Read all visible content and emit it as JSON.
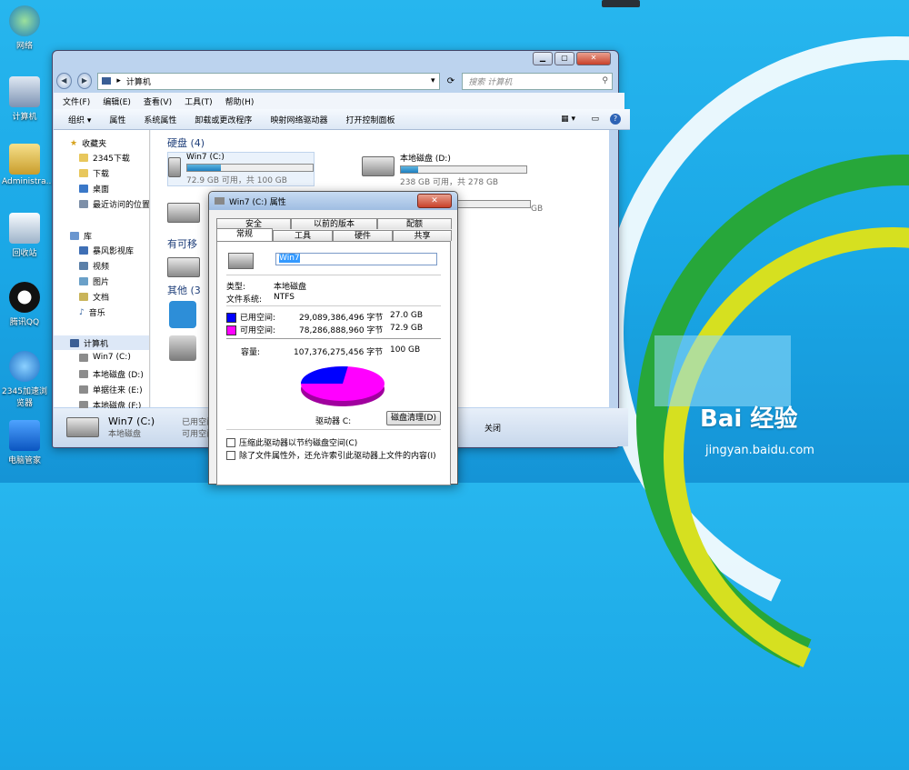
{
  "desktop": {
    "icons": [
      {
        "label": "网络",
        "name": "network-icon"
      },
      {
        "label": "计算机",
        "name": "computer-icon"
      },
      {
        "label": "Administra...",
        "name": "user-folder-icon"
      },
      {
        "label": "回收站",
        "name": "recycle-bin-icon"
      },
      {
        "label": "腾讯QQ",
        "name": "qq-icon"
      },
      {
        "label": "2345加速浏览器",
        "name": "browser-icon"
      },
      {
        "label": "电脑管家",
        "name": "pc-manager-icon"
      }
    ],
    "watermark": {
      "logo": "Bai 经验",
      "url": "jingyan.baidu.com"
    }
  },
  "explorer": {
    "address": "计算机",
    "search_placeholder": "搜索 计算机",
    "menu": [
      "文件(F)",
      "编辑(E)",
      "查看(V)",
      "工具(T)",
      "帮助(H)"
    ],
    "toolbar": [
      "组织 ▾",
      "属性",
      "系统属性",
      "卸载或更改程序",
      "映射网络驱动器",
      "打开控制面板"
    ],
    "sidebar": {
      "favorites": {
        "title": "收藏夹",
        "items": [
          "2345下载",
          "下载",
          "桌面",
          "最近访问的位置"
        ]
      },
      "libraries": {
        "title": "库",
        "items": [
          "暴风影视库",
          "视频",
          "图片",
          "文档",
          "音乐"
        ]
      },
      "computer": {
        "title": "计算机",
        "items": [
          "Win7 (C:)",
          "本地磁盘 (D:)",
          "单据往来 (E:)",
          "本地磁盘 (F:)"
        ]
      }
    },
    "sections": {
      "hard_disks": "硬盘 (4)",
      "removable": "有可移",
      "other": "其他 (3"
    },
    "drives": [
      {
        "name": "Win7 (C:)",
        "free": "72.9 GB 可用，共 100 GB",
        "used_fraction": 0.27
      },
      {
        "name": "本地磁盘 (D:)",
        "free": "238 GB 可用，共 278 GB",
        "used_fraction": 0.14
      }
    ],
    "partial_drive_free": "GB",
    "status": {
      "name": "Win7 (C:)",
      "type": "本地磁盘",
      "used_label": "已用空间:",
      "free_label": "可用空间: 72.9",
      "extra": "关闭"
    }
  },
  "dialog": {
    "title": "Win7 (C:) 属性",
    "close": "✕",
    "tabs_row1": [
      "安全",
      "以前的版本",
      "配额"
    ],
    "tabs_row2": [
      "常规",
      "工具",
      "硬件",
      "共享"
    ],
    "volume_label": "Win7",
    "type_label": "类型:",
    "type_value": "本地磁盘",
    "fs_label": "文件系统:",
    "fs_value": "NTFS",
    "used_label": "已用空间:",
    "used_bytes": "29,089,386,496 字节",
    "used_gb": "27.0 GB",
    "free_label": "可用空间:",
    "free_bytes": "78,286,888,960 字节",
    "free_gb": "72.9 GB",
    "capacity_label": "容量:",
    "capacity_bytes": "107,376,275,456 字节",
    "capacity_gb": "100 GB",
    "drive_label": "驱动器 C:",
    "cleanup_button": "磁盘清理(D)",
    "check_compress": "压缩此驱动器以节约磁盘空间(C)",
    "check_index": "除了文件属性外，还允许索引此驱动器上文件的内容(I)",
    "used_fraction": 0.27,
    "colors": {
      "used": "#0000ff",
      "free": "#ff00ff"
    }
  }
}
